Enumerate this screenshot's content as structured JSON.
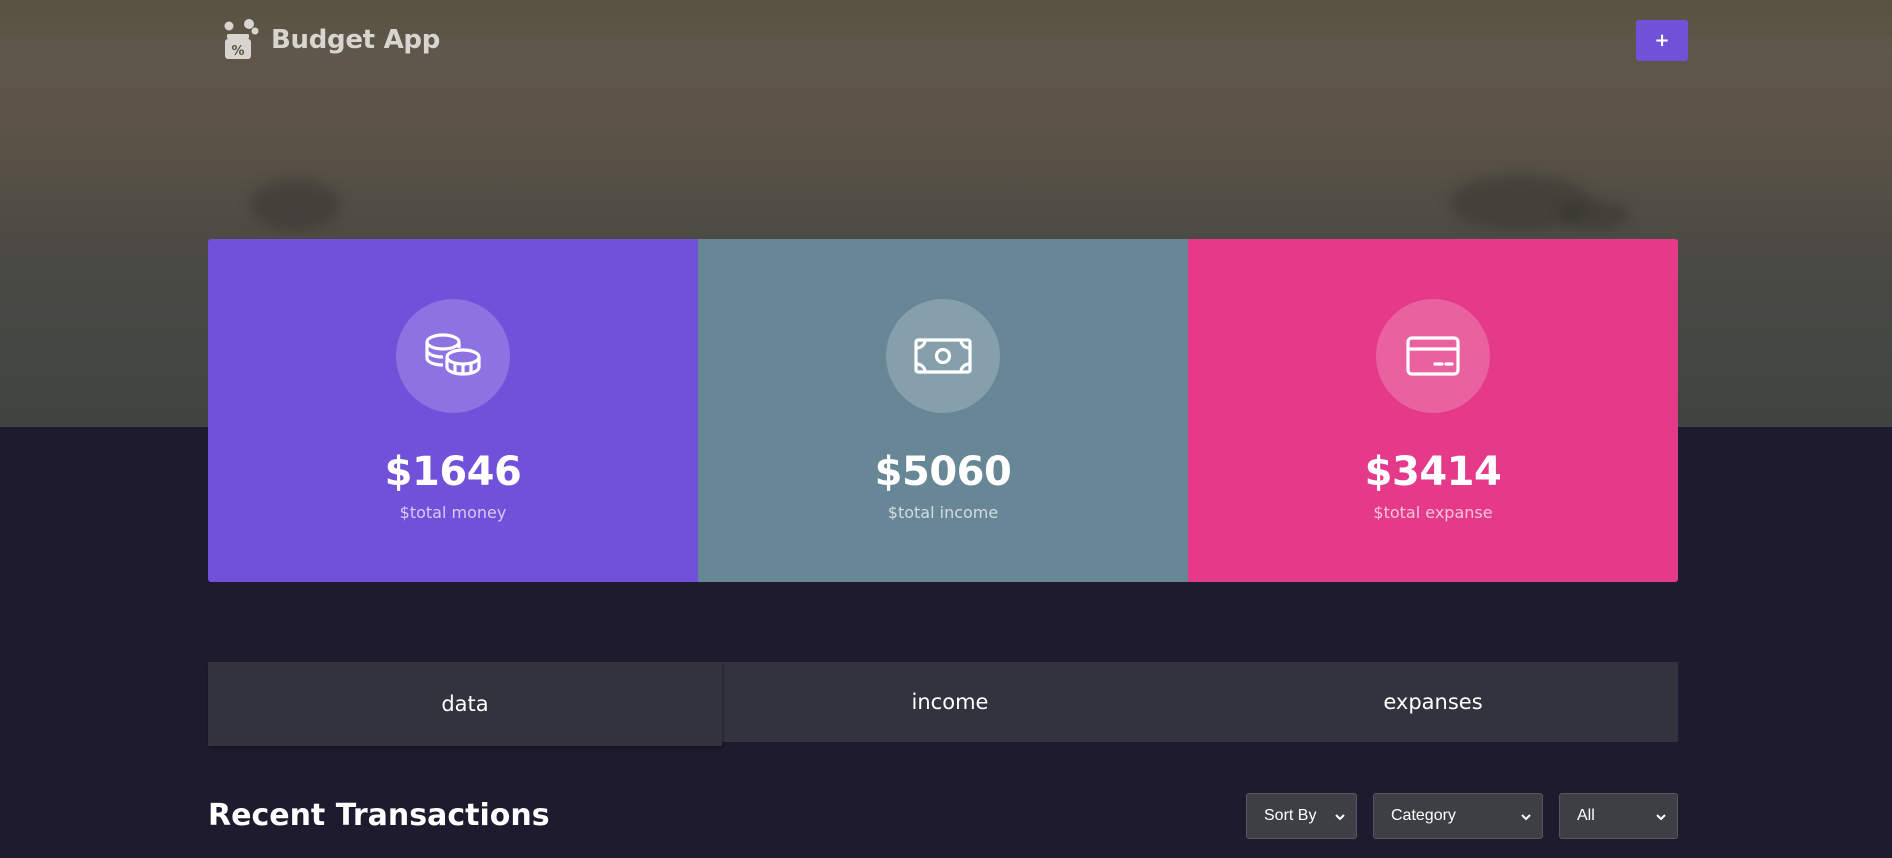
{
  "app": {
    "title": "Budget App",
    "add_button_label": "+"
  },
  "cards": [
    {
      "amount": "$1646",
      "label": "$total money",
      "icon": "coins-icon",
      "color": "#7151da"
    },
    {
      "amount": "$5060",
      "label": "$total income",
      "icon": "banknote-icon",
      "color": "#678796"
    },
    {
      "amount": "$3414",
      "label": "$total expanse",
      "icon": "credit-card-icon",
      "color": "#e53a89"
    }
  ],
  "tabs": [
    {
      "label": "data",
      "active": true
    },
    {
      "label": "income",
      "active": false
    },
    {
      "label": "expanses",
      "active": false
    }
  ],
  "transactions": {
    "title": "Recent Transactions",
    "filters": {
      "sort": "Sort By",
      "category": "Category",
      "type": "All"
    }
  },
  "colors": {
    "accent": "#7052d9",
    "background": "#1e1b2e",
    "tab_bar": "#31343f"
  }
}
